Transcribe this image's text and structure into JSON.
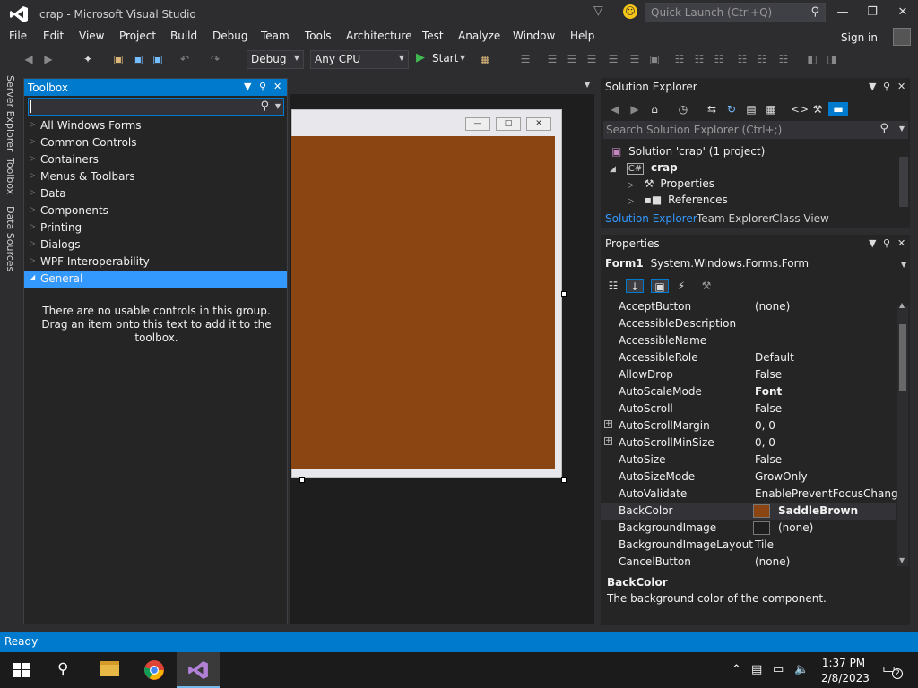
{
  "window": {
    "title": "crap - Microsoft Visual Studio"
  },
  "quick_launch": {
    "placeholder": "Quick Launch (Ctrl+Q)"
  },
  "menu": [
    "File",
    "Edit",
    "View",
    "Project",
    "Build",
    "Debug",
    "Team",
    "Tools",
    "Architecture",
    "Test",
    "Analyze",
    "Window",
    "Help"
  ],
  "account": {
    "signin": "Sign in"
  },
  "toolbar": {
    "config": "Debug",
    "platform": "Any CPU",
    "start": "Start"
  },
  "left_tabs": [
    "Server Explorer",
    "Toolbox",
    "Data Sources"
  ],
  "toolbox": {
    "title": "Toolbox",
    "groups": [
      "All Windows Forms",
      "Common Controls",
      "Containers",
      "Menus & Toolbars",
      "Data",
      "Components",
      "Printing",
      "Dialogs",
      "WPF Interoperability"
    ],
    "selected_group": "General",
    "empty_message": "There are no usable controls in this group. Drag an item onto this text to add it to the toolbox."
  },
  "form": {
    "backcolor": "#8B4513"
  },
  "solution_explorer": {
    "title": "Solution Explorer",
    "search_placeholder": "Search Solution Explorer (Ctrl+;)",
    "solution": "Solution 'crap' (1 project)",
    "project": "crap",
    "items": [
      "Properties",
      "References"
    ],
    "tabs": [
      "Solution Explorer",
      "Team Explorer",
      "Class View"
    ]
  },
  "properties": {
    "title": "Properties",
    "object_name": "Form1",
    "object_type": "System.Windows.Forms.Form",
    "rows": [
      {
        "name": "AcceptButton",
        "value": "(none)"
      },
      {
        "name": "AccessibleDescription",
        "value": ""
      },
      {
        "name": "AccessibleName",
        "value": ""
      },
      {
        "name": "AccessibleRole",
        "value": "Default"
      },
      {
        "name": "AllowDrop",
        "value": "False"
      },
      {
        "name": "AutoScaleMode",
        "value": "Font"
      },
      {
        "name": "AutoScroll",
        "value": "False"
      },
      {
        "name": "AutoScrollMargin",
        "value": "0, 0"
      },
      {
        "name": "AutoScrollMinSize",
        "value": "0, 0"
      },
      {
        "name": "AutoSize",
        "value": "False"
      },
      {
        "name": "AutoSizeMode",
        "value": "GrowOnly"
      },
      {
        "name": "AutoValidate",
        "value": "EnablePreventFocusChange"
      },
      {
        "name": "BackColor",
        "value": "SaddleBrown"
      },
      {
        "name": "BackgroundImage",
        "value": "(none)"
      },
      {
        "name": "BackgroundImageLayout",
        "value": "Tile"
      },
      {
        "name": "CancelButton",
        "value": "(none)"
      }
    ],
    "desc_title": "BackColor",
    "desc_text": "The background color of the component."
  },
  "status": {
    "text": "Ready"
  },
  "taskbar": {
    "time": "1:37 PM",
    "date": "2/8/2023",
    "notifications": "2"
  },
  "colors": {
    "accent": "#007acc",
    "backcolor_swatch": "#8B4513",
    "bgimage_swatch": "#1e1e1e"
  }
}
